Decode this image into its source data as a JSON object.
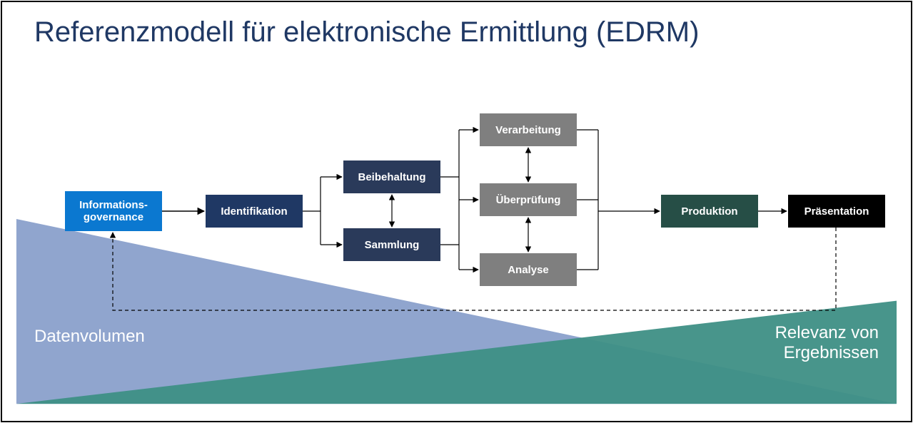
{
  "title": "Referenzmodell für elektronische Ermittlung (EDRM)",
  "boxes": {
    "info_governance": "Informations-\ngovernance",
    "identification": "Identifikation",
    "preservation": "Beibehaltung",
    "collection": "Sammlung",
    "processing": "Verarbeitung",
    "review": "Überprüfung",
    "analysis": "Analyse",
    "production": "Produktion",
    "presentation": "Präsentation"
  },
  "labels": {
    "volume": "Datenvolumen",
    "relevance": "Relevanz von\nErgebnissen"
  }
}
